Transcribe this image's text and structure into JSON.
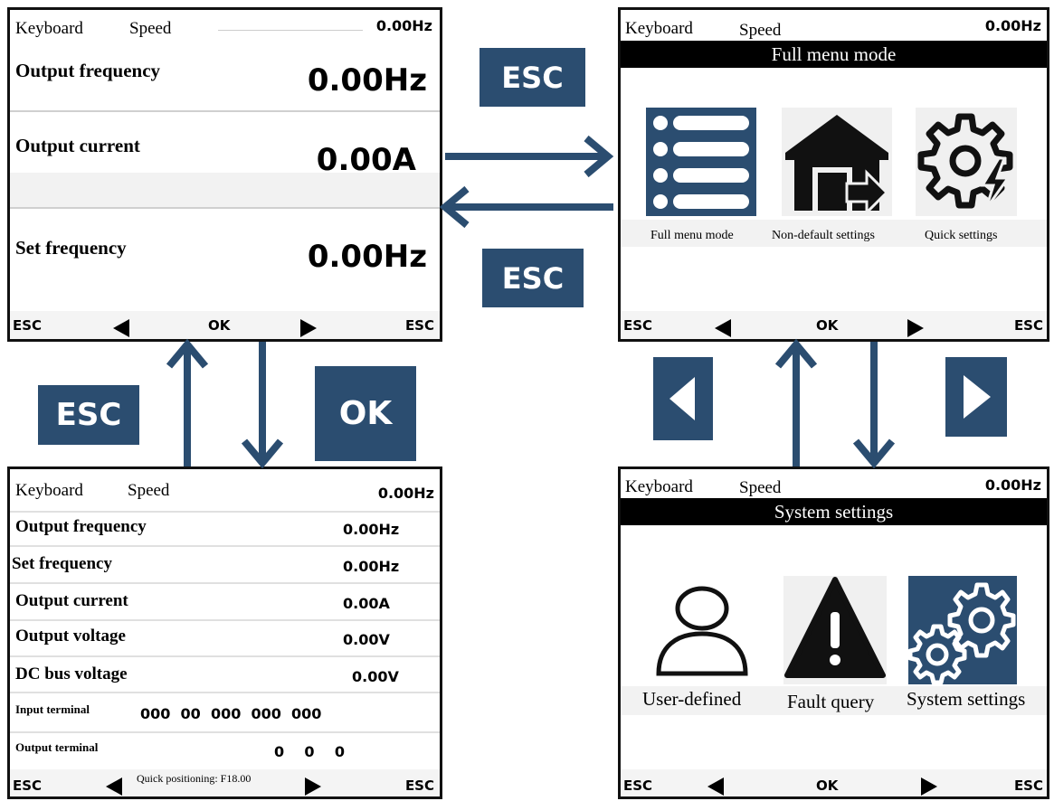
{
  "common": {
    "keyboard": "Keyboard",
    "speed": "Speed",
    "top_value": "0.00Hz",
    "esc": "ESC",
    "ok": "OK"
  },
  "screen1": {
    "rows": [
      {
        "label": "Output frequency",
        "value": "0.00Hz"
      },
      {
        "label": "Output current",
        "value": "0.00A"
      },
      {
        "label": "Set frequency",
        "value": "0.00Hz"
      }
    ]
  },
  "screen2": {
    "title": "Full menu mode",
    "items": [
      {
        "label": "Full menu mode",
        "icon": "list-menu-icon"
      },
      {
        "label": "Non-default settings",
        "icon": "house-arrow-icon"
      },
      {
        "label": "Quick settings",
        "icon": "gear-lightning-icon"
      }
    ]
  },
  "screen3": {
    "rows": [
      {
        "label": "Output frequency",
        "value": "0.00Hz"
      },
      {
        "label": "Set frequency",
        "value": "0.00Hz"
      },
      {
        "label": "Output current",
        "value": "0.00A"
      },
      {
        "label": "Output voltage",
        "value": "0.00V"
      },
      {
        "label": "DC bus voltage",
        "value": "0.00V"
      }
    ],
    "input_terminal": {
      "label": "Input terminal",
      "value": "000  00  000  000  000"
    },
    "output_terminal": {
      "label": "Output terminal",
      "value": "0    0    0"
    },
    "quick_positioning": "Quick positioning: F18.00"
  },
  "screen4": {
    "title": "System settings",
    "items": [
      {
        "label": "User-defined",
        "icon": "user-icon"
      },
      {
        "label": "Fault query",
        "icon": "warning-icon"
      },
      {
        "label": "System settings",
        "icon": "gears-icon"
      }
    ]
  },
  "keys": {
    "esc_top": "ESC",
    "esc_mid": "ESC",
    "esc_left": "ESC",
    "ok_left": "OK"
  },
  "colors": {
    "key_blue": "#2b4d70"
  }
}
